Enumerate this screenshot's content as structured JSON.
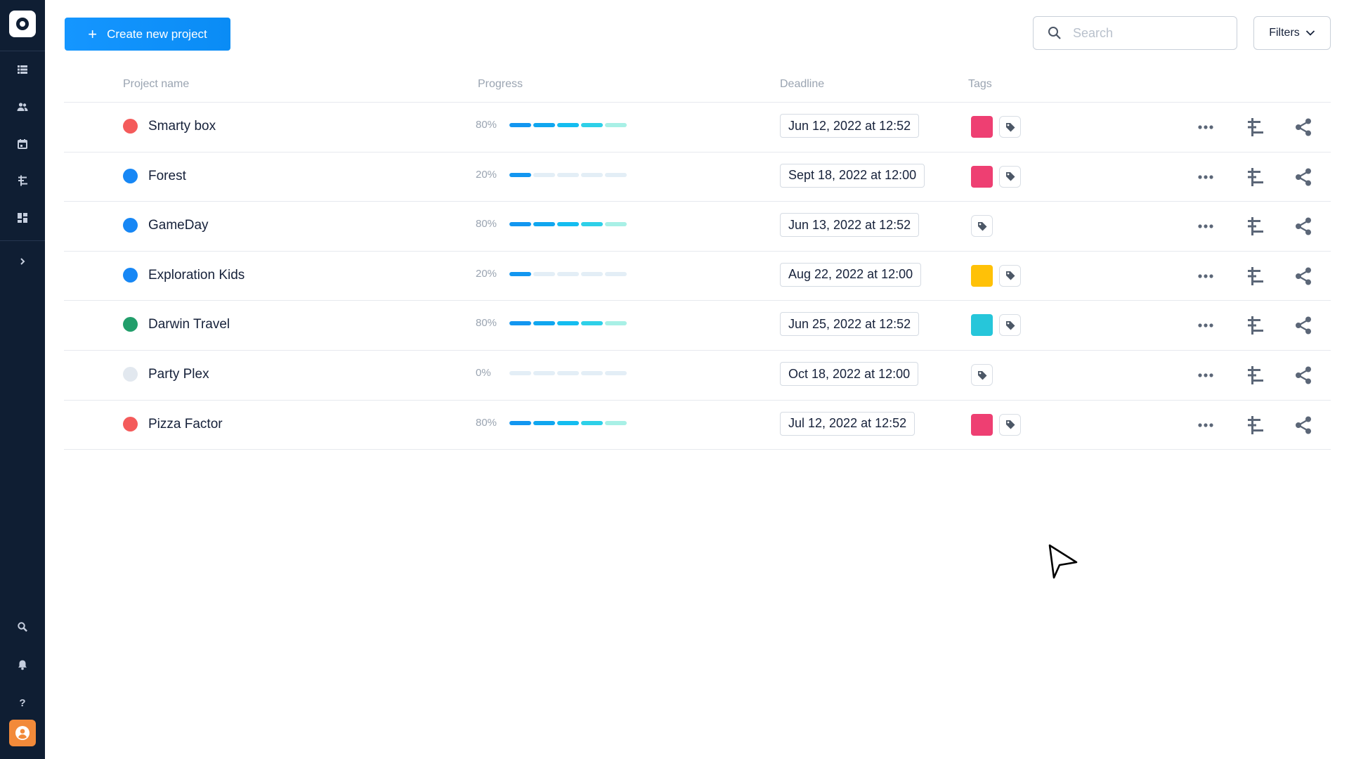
{
  "toolbar": {
    "create_label": "Create new project",
    "search_placeholder": "Search",
    "filters_label": "Filters"
  },
  "table": {
    "headers": {
      "name": "Project name",
      "progress": "Progress",
      "deadline": "Deadline",
      "tags": "Tags"
    },
    "rows": [
      {
        "name": "Smarty box",
        "status_color": "#f45b5b",
        "progress": 80,
        "progress_label": "80%",
        "deadline": "Jun 12, 2022 at 12:52",
        "tag_color": "#ee3f72"
      },
      {
        "name": "Forest",
        "status_color": "#1787f5",
        "progress": 20,
        "progress_label": "20%",
        "deadline": "Sept 18, 2022 at 12:00",
        "tag_color": "#ee3f72"
      },
      {
        "name": "GameDay",
        "status_color": "#1787f5",
        "progress": 80,
        "progress_label": "80%",
        "deadline": "Jun 13, 2022 at 12:52",
        "tag_color": null
      },
      {
        "name": "Exploration Kids",
        "status_color": "#1787f5",
        "progress": 20,
        "progress_label": "20%",
        "deadline": "Aug 22, 2022 at 12:00",
        "tag_color": "#ffc107"
      },
      {
        "name": "Darwin Travel",
        "status_color": "#229e6b",
        "progress": 80,
        "progress_label": "80%",
        "deadline": "Jun 25, 2022 at 12:52",
        "tag_color": "#26c6da"
      },
      {
        "name": "Party Plex",
        "status_color": "#e2e8ef",
        "progress": 0,
        "progress_label": "0%",
        "deadline": "Oct 18, 2022 at 12:00",
        "tag_color": null
      },
      {
        "name": "Pizza Factor",
        "status_color": "#f45b5b",
        "progress": 80,
        "progress_label": "80%",
        "deadline": "Jul 12, 2022 at 12:52",
        "tag_color": "#ee3f72"
      }
    ]
  },
  "sidebar": {
    "items": [
      "list-icon",
      "team-icon",
      "calendar-icon",
      "timeline-icon",
      "dashboard-icon",
      "expand-chevron-icon",
      "search-icon",
      "bell-icon",
      "help-icon",
      "user-avatar-icon"
    ]
  },
  "colors": {
    "sidebar_bg": "#0f1e33",
    "accent": "#1596ff",
    "muted_text": "#9aa4b1",
    "avatar_bg": "#f28a3a"
  }
}
